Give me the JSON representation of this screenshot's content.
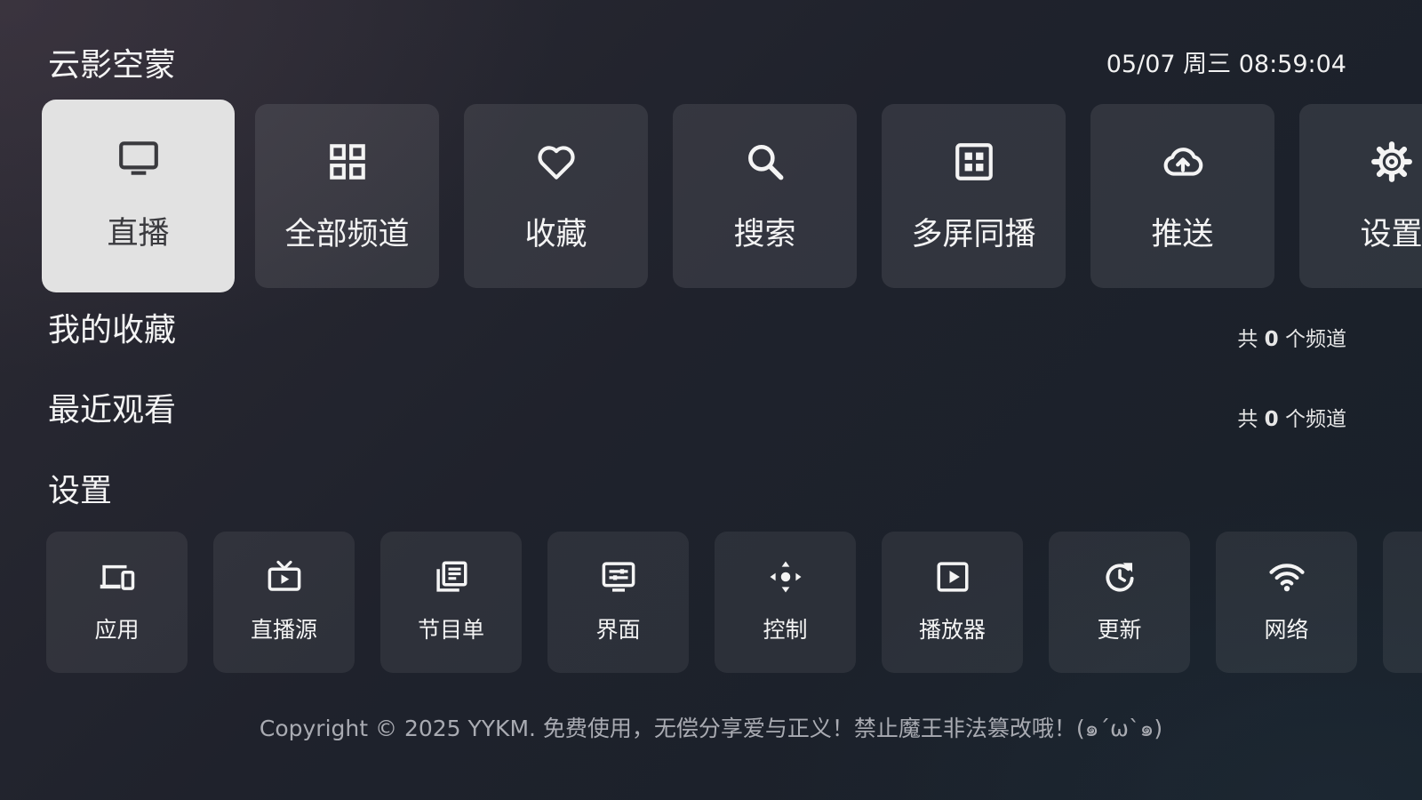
{
  "header": {
    "app_title": "云影空蒙",
    "datetime": "05/07 周三 08:59:04"
  },
  "nav": {
    "items": [
      {
        "label": "直播",
        "icon": "tv-icon",
        "active": true
      },
      {
        "label": "全部频道",
        "icon": "grid-icon"
      },
      {
        "label": "收藏",
        "icon": "heart-icon"
      },
      {
        "label": "搜索",
        "icon": "search-icon"
      },
      {
        "label": "多屏同播",
        "icon": "multiscreen-icon"
      },
      {
        "label": "推送",
        "icon": "cloud-upload-icon"
      },
      {
        "label": "设置",
        "icon": "gear-icon"
      }
    ]
  },
  "favorites": {
    "title": "我的收藏",
    "count_prefix": "共",
    "count": "0",
    "count_suffix": "个频道"
  },
  "recent": {
    "title": "最近观看",
    "count_prefix": "共",
    "count": "0",
    "count_suffix": "个频道"
  },
  "settings": {
    "title": "设置",
    "items": [
      {
        "label": "应用",
        "icon": "devices-icon"
      },
      {
        "label": "直播源",
        "icon": "live-tv-icon"
      },
      {
        "label": "节目单",
        "icon": "library-books-icon"
      },
      {
        "label": "界面",
        "icon": "settings-display-icon"
      },
      {
        "label": "控制",
        "icon": "dpad-icon"
      },
      {
        "label": "播放器",
        "icon": "play-icon"
      },
      {
        "label": "更新",
        "icon": "refresh-icon"
      },
      {
        "label": "网络",
        "icon": "wifi-icon"
      }
    ]
  },
  "footer": {
    "copyright": "Copyright © 2025 YYKM. 免费使用，无偿分享爱与正义！禁止魔王非法篡改哦！(๑´ω`๑)"
  },
  "colors": {
    "active_card_bg": "#e2e2e2",
    "card_bg": "rgba(255,255,255,0.09)",
    "text": "#f4f4f4",
    "muted_text": "#a9abb2"
  }
}
